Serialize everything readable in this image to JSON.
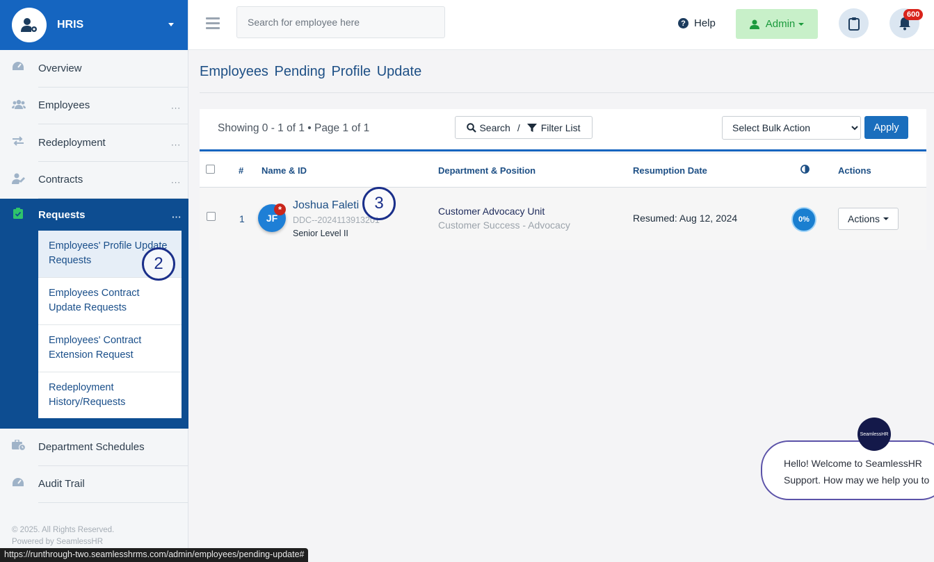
{
  "brand": {
    "title": "HRIS"
  },
  "sidebar": {
    "items": [
      {
        "label": "Overview",
        "dots": ""
      },
      {
        "label": "Employees",
        "dots": "..."
      },
      {
        "label": "Redeployment",
        "dots": "..."
      },
      {
        "label": "Contracts",
        "dots": "..."
      }
    ],
    "requests": {
      "label": "Requests",
      "dots": "...",
      "subitems": [
        {
          "label": "Employees' Profile Update Requests"
        },
        {
          "label": "Employees Contract Update Requests"
        },
        {
          "label": "Employees' Contract Extension Request"
        },
        {
          "label": "Redeployment History/Requests"
        }
      ]
    },
    "lower_items": [
      {
        "label": "Department Schedules"
      },
      {
        "label": "Audit Trail"
      }
    ],
    "footer": {
      "copyright": "© 2025. All Rights Reserved.",
      "powered": "Powered by SeamlessHR"
    }
  },
  "topbar": {
    "search_placeholder": "Search for employee here",
    "help_label": "Help",
    "admin_label": "Admin",
    "notification_count": "600"
  },
  "page": {
    "title": "Employees Pending Profile Update"
  },
  "toolbar": {
    "showing": "Showing 0 - 1 of 1 • Page 1 of 1",
    "search_label": "Search",
    "separator": "/",
    "filter_label": "Filter List",
    "bulk_placeholder": "Select Bulk Action",
    "apply_label": "Apply"
  },
  "table": {
    "headers": {
      "index": "#",
      "name": "Name & ID",
      "department": "Department & Position",
      "resumption": "Resumption Date",
      "actions": "Actions"
    },
    "rows": [
      {
        "index": "1",
        "initials": "JF",
        "marker": "*",
        "name": "Joshua Faleti",
        "employee_id": "DDC--2024113913201",
        "level": "Senior Level II",
        "department": "Customer Advocacy Unit",
        "position": "Customer Success - Advocacy",
        "resumption": "Resumed: Aug 12, 2024",
        "progress": "0%",
        "actions_label": "Actions"
      }
    ]
  },
  "annotations": {
    "step2": "2",
    "step3": "3"
  },
  "chat": {
    "logo_text": "SeamlessHR",
    "message": "Hello! Welcome to SeamlessHR Support. How may we help you to"
  },
  "statusbar": {
    "url": "https://runthrough-two.seamlesshrms.com/admin/employees/pending-update#"
  },
  "colors": {
    "primary": "#1565c0",
    "sidebar_active": "#0d4d91",
    "admin_bg": "#c8f0c9",
    "badge": "#d9241c"
  }
}
